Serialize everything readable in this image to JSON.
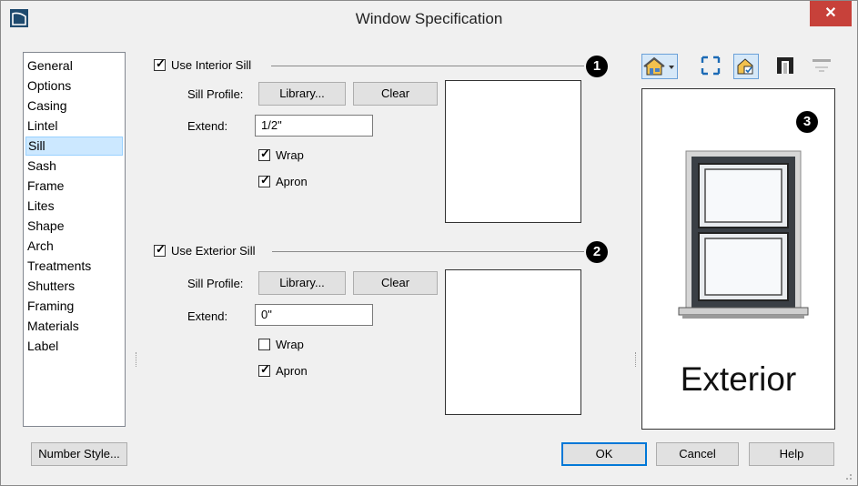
{
  "window": {
    "title": "Window Specification",
    "close_glyph": "✕"
  },
  "nav": {
    "items": [
      {
        "label": "General"
      },
      {
        "label": "Options"
      },
      {
        "label": "Casing"
      },
      {
        "label": "Lintel"
      },
      {
        "label": "Sill",
        "selected": true
      },
      {
        "label": "Sash"
      },
      {
        "label": "Frame"
      },
      {
        "label": "Lites"
      },
      {
        "label": "Shape"
      },
      {
        "label": "Arch"
      },
      {
        "label": "Treatments"
      },
      {
        "label": "Shutters"
      },
      {
        "label": "Framing"
      },
      {
        "label": "Materials"
      },
      {
        "label": "Label"
      }
    ]
  },
  "interior": {
    "use_label": "Use Interior Sill",
    "use_checked": true,
    "badge": "1",
    "profile_label": "Sill Profile:",
    "library_label": "Library...",
    "clear_label": "Clear",
    "extend_label": "Extend:",
    "extend_value": "1/2\"",
    "wrap_label": "Wrap",
    "wrap_checked": true,
    "apron_label": "Apron",
    "apron_checked": true
  },
  "exterior": {
    "use_label": "Use Exterior Sill",
    "use_checked": true,
    "badge": "2",
    "profile_label": "Sill Profile:",
    "library_label": "Library...",
    "clear_label": "Clear",
    "extend_label": "Extend:",
    "extend_value": "0\"",
    "wrap_label": "Wrap",
    "wrap_checked": false,
    "apron_label": "Apron",
    "apron_checked": true
  },
  "preview": {
    "badge": "3",
    "view_label": "Exterior",
    "toolbar": [
      "house-view-dropdown-icon",
      "fit-to-window-icon",
      "show-details-icon",
      "frame-view-icon",
      "sill-view-icon"
    ]
  },
  "footer": {
    "number_style_label": "Number Style...",
    "ok_label": "OK",
    "cancel_label": "Cancel",
    "help_label": "Help"
  },
  "colors": {
    "accent": "#0078d7",
    "selection": "#cce8ff",
    "close": "#c7413a"
  }
}
